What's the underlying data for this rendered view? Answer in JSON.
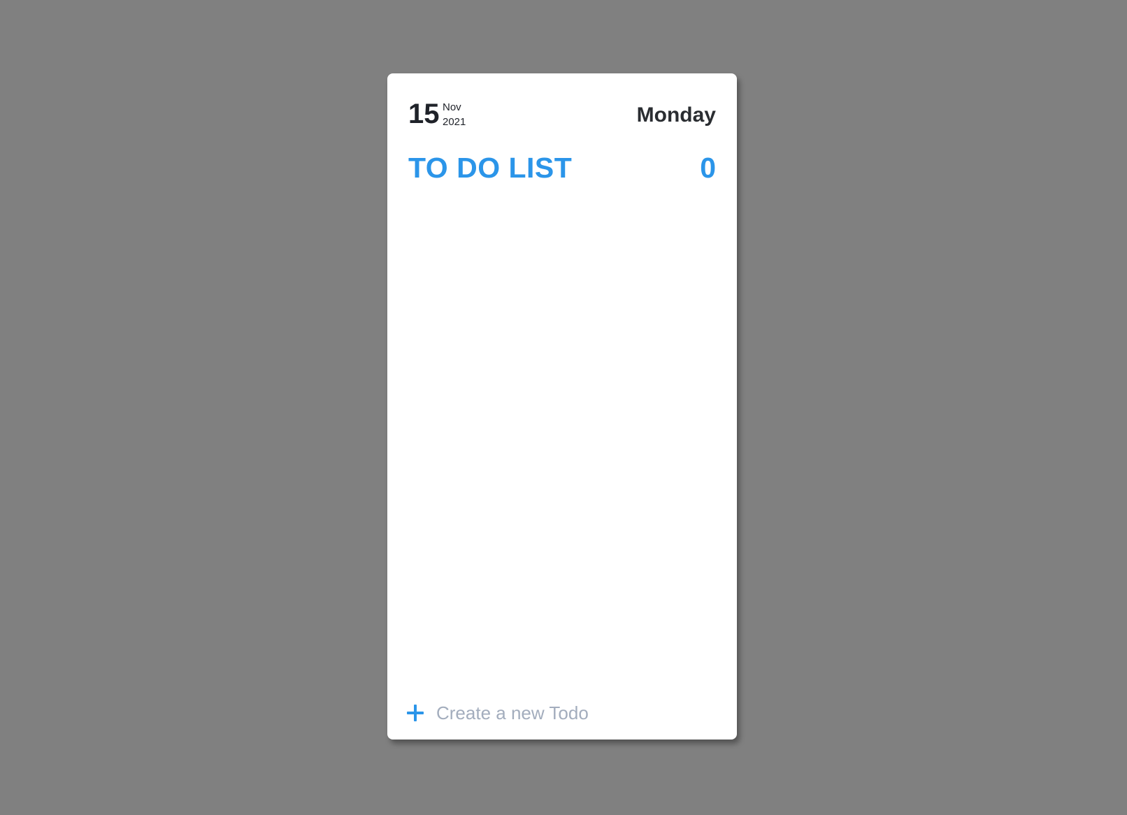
{
  "date": {
    "day": "15",
    "month": "Nov",
    "year": "2021",
    "weekday": "Monday"
  },
  "list": {
    "title": "TO DO LIST",
    "count": "0",
    "items": []
  },
  "new_todo": {
    "placeholder": "Create a new Todo",
    "value": ""
  },
  "colors": {
    "accent": "#2b95e9",
    "background": "#808080",
    "card": "#ffffff",
    "placeholder": "#a3adbd",
    "text_dark": "#1f2229"
  },
  "icons": {
    "add": "plus-icon"
  }
}
